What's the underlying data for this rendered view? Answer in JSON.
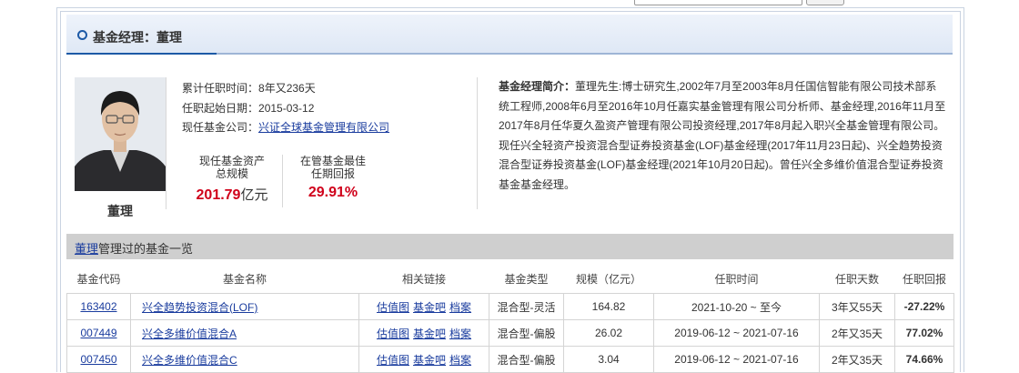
{
  "header": {
    "title": "基金经理：董理"
  },
  "manager": {
    "name": "董理",
    "tenure_label": "累计任职时间：",
    "tenure_value": "8年又236天",
    "start_label": "任职起始日期：",
    "start_value": "2015-03-12",
    "company_label": "现任基金公司：",
    "company_value": "兴证全球基金管理有限公司",
    "aum_label_1": "现任基金资产",
    "aum_label_2": "总规模",
    "aum_value": "201.79",
    "aum_unit": "亿元",
    "best_label_1": "在管基金最佳",
    "best_label_2": "任期回报",
    "best_value": "29.91%",
    "bio_label": "基金经理简介：",
    "bio_text": "董理先生:博士研究生,2002年7月至2003年8月任国信智能有限公司技术部系统工程师,2008年6月至2016年10月任嘉实基金管理有限公司分析师、基金经理,2016年11月至2017年8月任华夏久盈资产管理有限公司投资经理,2017年8月起入职兴全基金管理有限公司。现任兴全轻资产投资混合型证券投资基金(LOF)基金经理(2017年11月23日起)、兴全趋势投资混合型证券投资基金(LOF)基金经理(2021年10月20日起)。曾任兴全多维价值混合型证券投资基金基金经理。"
  },
  "fund_list": {
    "title_link": "董理",
    "title_rest": "管理过的基金一览",
    "columns": [
      "基金代码",
      "基金名称",
      "相关链接",
      "基金类型",
      "规模（亿元）",
      "任职时间",
      "任职天数",
      "任职回报"
    ],
    "link_labels": [
      "估值图",
      "基金吧",
      "档案"
    ],
    "rows": [
      {
        "code": "163402",
        "name": "兴全趋势投资混合(LOF)",
        "type": "混合型-灵活",
        "size": "164.82",
        "period": "2021-10-20 ~ 至今",
        "days": "3年又55天",
        "return": "-27.22%"
      },
      {
        "code": "007449",
        "name": "兴全多维价值混合A",
        "type": "混合型-偏股",
        "size": "26.02",
        "period": "2019-06-12 ~ 2021-07-16",
        "days": "2年又35天",
        "return": "77.02%"
      },
      {
        "code": "007450",
        "name": "兴全多维价值混合C",
        "type": "混合型-偏股",
        "size": "3.04",
        "period": "2019-06-12 ~ 2021-07-16",
        "days": "2年又35天",
        "return": "74.66%"
      }
    ]
  },
  "colors": {
    "accent": "#1d5aa6",
    "positive": "#d0021b",
    "negative": "#0a8a2a",
    "link": "#1a3c9e"
  }
}
